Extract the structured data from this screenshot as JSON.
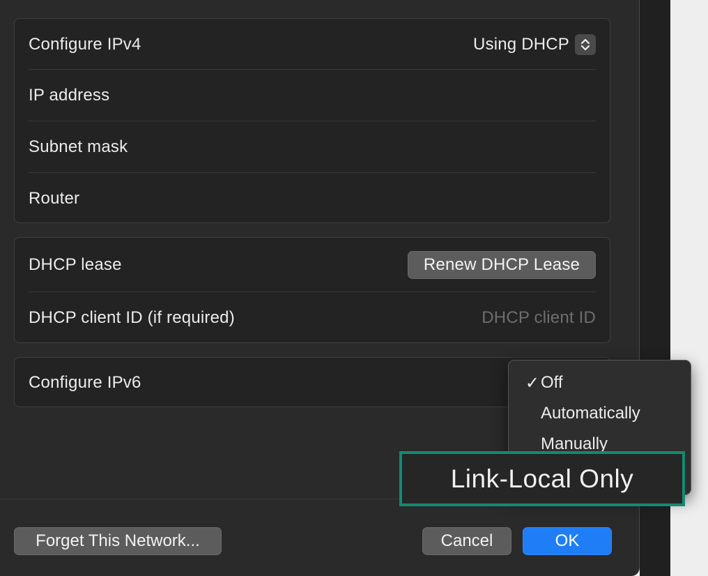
{
  "ipv4": {
    "configure_label": "Configure IPv4",
    "configure_value": "Using DHCP",
    "ip_address_label": "IP address",
    "subnet_mask_label": "Subnet mask",
    "router_label": "Router"
  },
  "dhcp": {
    "lease_label": "DHCP lease",
    "renew_button": "Renew DHCP Lease",
    "client_id_label": "DHCP client ID (if required)",
    "client_id_placeholder": "DHCP client ID"
  },
  "ipv6": {
    "configure_label": "Configure IPv6",
    "menu": {
      "options": [
        {
          "label": "Off",
          "checked": true
        },
        {
          "label": "Automatically",
          "checked": false
        },
        {
          "label": "Manually",
          "checked": false
        },
        {
          "label": "Link-Local Only",
          "checked": false
        }
      ],
      "check_glyph": "✓"
    }
  },
  "footer": {
    "forget_button": "Forget This Network...",
    "cancel_button": "Cancel",
    "ok_button": "OK"
  },
  "colors": {
    "accent": "#1f7ef5",
    "highlight_border": "#138a70"
  }
}
